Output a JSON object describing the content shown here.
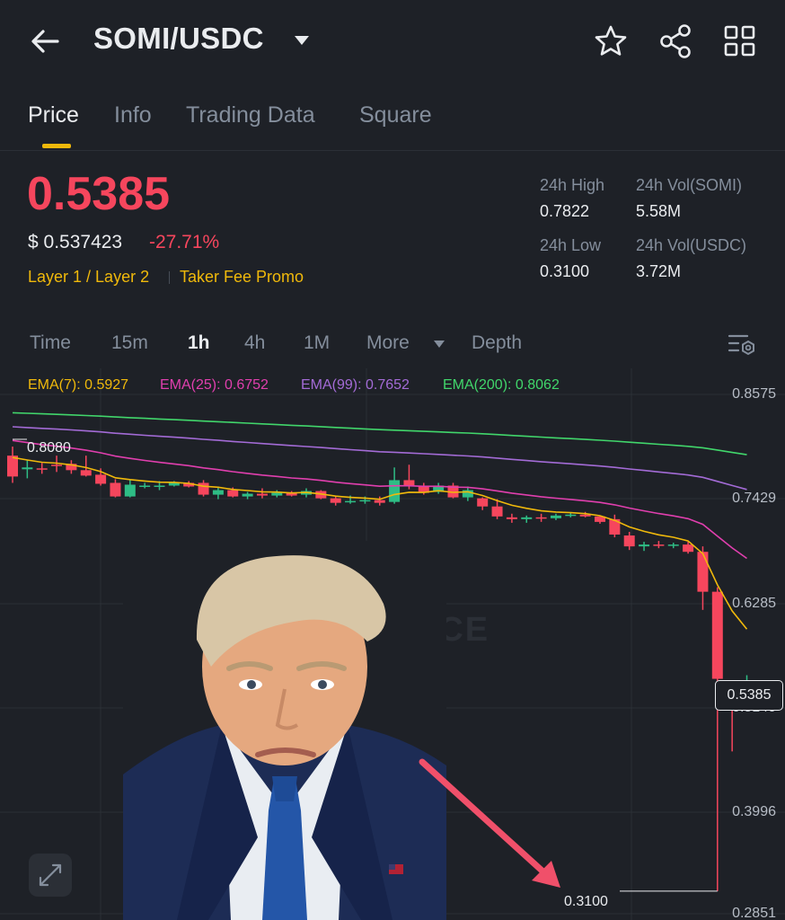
{
  "header": {
    "pair": "SOMI/USDC"
  },
  "tabs": [
    "Price",
    "Info",
    "Trading Data",
    "Square"
  ],
  "price": {
    "last": "0.5385",
    "usd": "$ 0.537423",
    "change": "-27.71%",
    "tag1": "Layer 1 / Layer 2",
    "tag2": "Taker Fee Promo"
  },
  "stats": {
    "high_label": "24h High",
    "high_value": "0.7822",
    "low_label": "24h Low",
    "low_value": "0.3100",
    "vol_base_label": "24h Vol(SOMI)",
    "vol_base_value": "5.58M",
    "vol_quote_label": "24h Vol(USDC)",
    "vol_quote_value": "3.72M"
  },
  "intervals": {
    "items": [
      "Time",
      "15m",
      "1h",
      "4h",
      "1M",
      "More",
      "Depth"
    ],
    "active": "1h"
  },
  "ema": {
    "ema7": "EMA(7): 0.5927",
    "ema25": "EMA(25): 0.6752",
    "ema99": "EMA(99): 0.7652",
    "ema200": "EMA(200): 0.8062"
  },
  "colors": {
    "up": "#2ebd85",
    "down": "#f6465d",
    "ema7": "#f0b90b",
    "ema25": "#e03fae",
    "ema99": "#a36bd6",
    "ema200": "#41d66b",
    "accent": "#f0b90b"
  },
  "chart_data": {
    "type": "candlestick",
    "y_ticks": [
      "0.8575",
      "0.7429",
      "0.6285",
      "0.5140",
      "0.3996",
      "0.2851"
    ],
    "ylim": [
      0.2851,
      0.8575
    ],
    "current_price": "0.5385",
    "marked_high": "0.8080",
    "marked_low": "0.3100",
    "watermark": "NANCE",
    "candles": [
      {
        "o": 0.79,
        "h": 0.8,
        "l": 0.76,
        "c": 0.767
      },
      {
        "o": 0.775,
        "h": 0.785,
        "l": 0.765,
        "c": 0.777
      },
      {
        "o": 0.776,
        "h": 0.782,
        "l": 0.77,
        "c": 0.775
      },
      {
        "o": 0.78,
        "h": 0.79,
        "l": 0.772,
        "c": 0.779
      },
      {
        "o": 0.781,
        "h": 0.785,
        "l": 0.77,
        "c": 0.774
      },
      {
        "o": 0.774,
        "h": 0.79,
        "l": 0.767,
        "c": 0.768
      },
      {
        "o": 0.769,
        "h": 0.776,
        "l": 0.757,
        "c": 0.759
      },
      {
        "o": 0.76,
        "h": 0.764,
        "l": 0.744,
        "c": 0.745
      },
      {
        "o": 0.745,
        "h": 0.763,
        "l": 0.744,
        "c": 0.758
      },
      {
        "o": 0.756,
        "h": 0.76,
        "l": 0.754,
        "c": 0.757
      },
      {
        "o": 0.757,
        "h": 0.762,
        "l": 0.752,
        "c": 0.757
      },
      {
        "o": 0.757,
        "h": 0.762,
        "l": 0.756,
        "c": 0.76
      },
      {
        "o": 0.76,
        "h": 0.762,
        "l": 0.755,
        "c": 0.756
      },
      {
        "o": 0.76,
        "h": 0.763,
        "l": 0.745,
        "c": 0.747
      },
      {
        "o": 0.747,
        "h": 0.756,
        "l": 0.742,
        "c": 0.752
      },
      {
        "o": 0.752,
        "h": 0.755,
        "l": 0.744,
        "c": 0.745
      },
      {
        "o": 0.745,
        "h": 0.75,
        "l": 0.742,
        "c": 0.748
      },
      {
        "o": 0.748,
        "h": 0.754,
        "l": 0.743,
        "c": 0.746
      },
      {
        "o": 0.746,
        "h": 0.752,
        "l": 0.744,
        "c": 0.749
      },
      {
        "o": 0.749,
        "h": 0.751,
        "l": 0.745,
        "c": 0.746
      },
      {
        "o": 0.747,
        "h": 0.754,
        "l": 0.744,
        "c": 0.751
      },
      {
        "o": 0.751,
        "h": 0.752,
        "l": 0.742,
        "c": 0.743
      },
      {
        "o": 0.743,
        "h": 0.746,
        "l": 0.735,
        "c": 0.738
      },
      {
        "o": 0.739,
        "h": 0.746,
        "l": 0.737,
        "c": 0.74
      },
      {
        "o": 0.74,
        "h": 0.745,
        "l": 0.737,
        "c": 0.741
      },
      {
        "o": 0.741,
        "h": 0.745,
        "l": 0.735,
        "c": 0.738
      },
      {
        "o": 0.739,
        "h": 0.777,
        "l": 0.737,
        "c": 0.763
      },
      {
        "o": 0.763,
        "h": 0.78,
        "l": 0.753,
        "c": 0.757
      },
      {
        "o": 0.757,
        "h": 0.76,
        "l": 0.747,
        "c": 0.749
      },
      {
        "o": 0.75,
        "h": 0.76,
        "l": 0.748,
        "c": 0.757
      },
      {
        "o": 0.757,
        "h": 0.76,
        "l": 0.743,
        "c": 0.744
      },
      {
        "o": 0.744,
        "h": 0.756,
        "l": 0.74,
        "c": 0.752
      },
      {
        "o": 0.743,
        "h": 0.744,
        "l": 0.73,
        "c": 0.734
      },
      {
        "o": 0.734,
        "h": 0.742,
        "l": 0.72,
        "c": 0.723
      },
      {
        "o": 0.722,
        "h": 0.726,
        "l": 0.716,
        "c": 0.72
      },
      {
        "o": 0.72,
        "h": 0.724,
        "l": 0.716,
        "c": 0.722
      },
      {
        "o": 0.722,
        "h": 0.726,
        "l": 0.717,
        "c": 0.721
      },
      {
        "o": 0.721,
        "h": 0.726,
        "l": 0.719,
        "c": 0.724
      },
      {
        "o": 0.724,
        "h": 0.727,
        "l": 0.722,
        "c": 0.725
      },
      {
        "o": 0.725,
        "h": 0.728,
        "l": 0.722,
        "c": 0.723
      },
      {
        "o": 0.723,
        "h": 0.724,
        "l": 0.715,
        "c": 0.717
      },
      {
        "o": 0.72,
        "h": 0.725,
        "l": 0.7,
        "c": 0.703
      },
      {
        "o": 0.702,
        "h": 0.706,
        "l": 0.686,
        "c": 0.69
      },
      {
        "o": 0.69,
        "h": 0.695,
        "l": 0.685,
        "c": 0.692
      },
      {
        "o": 0.692,
        "h": 0.696,
        "l": 0.688,
        "c": 0.691
      },
      {
        "o": 0.691,
        "h": 0.694,
        "l": 0.688,
        "c": 0.692
      },
      {
        "o": 0.692,
        "h": 0.695,
        "l": 0.682,
        "c": 0.684
      },
      {
        "o": 0.684,
        "h": 0.69,
        "l": 0.62,
        "c": 0.64
      },
      {
        "o": 0.64,
        "h": 0.645,
        "l": 0.31,
        "c": 0.544
      },
      {
        "o": 0.535,
        "h": 0.538,
        "l": 0.464,
        "c": 0.533
      },
      {
        "o": 0.53,
        "h": 0.548,
        "l": 0.53,
        "c": 0.5385
      }
    ]
  }
}
